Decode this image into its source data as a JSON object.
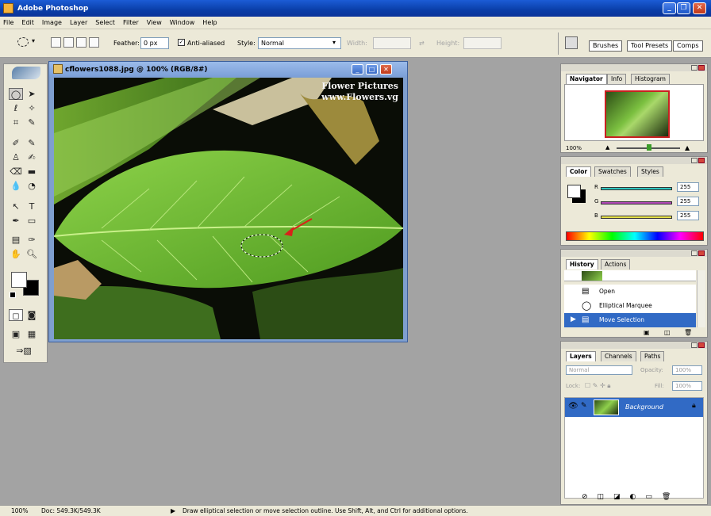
{
  "app": {
    "title": "Adobe Photoshop"
  },
  "menu": [
    "File",
    "Edit",
    "Image",
    "Layer",
    "Select",
    "Filter",
    "View",
    "Window",
    "Help"
  ],
  "options": {
    "feather_label": "Feather:",
    "feather_value": "0 px",
    "antialiased_label": "Anti-aliased",
    "style_label": "Style:",
    "style_value": "Normal",
    "width_label": "Width:",
    "height_label": "Height:",
    "tabs": [
      "Brushes",
      "Tool Presets",
      "Comps"
    ]
  },
  "document": {
    "title": "cflowers1088.jpg @ 100% (RGB/8#)",
    "watermark_line1": "Flower Pictures",
    "watermark_line2": "www.Flowers.vg"
  },
  "navigator": {
    "tabs": [
      "Navigator",
      "Info",
      "Histogram"
    ],
    "zoom": "100%"
  },
  "color": {
    "tabs": [
      "Color",
      "Swatches",
      "Styles"
    ],
    "channels": [
      {
        "label": "R",
        "value": "255",
        "color": "#2fc7c0"
      },
      {
        "label": "G",
        "value": "255",
        "color": "#b34ab8"
      },
      {
        "label": "B",
        "value": "255",
        "color": "#e4e04a"
      }
    ]
  },
  "history": {
    "tabs": [
      "History",
      "Actions"
    ],
    "items": [
      {
        "label": "Open",
        "icon": "document-icon"
      },
      {
        "label": "Elliptical Marquee",
        "icon": "ellipse-icon"
      },
      {
        "label": "Move Selection",
        "icon": "document-icon"
      }
    ]
  },
  "layers": {
    "tabs": [
      "Layers",
      "Channels",
      "Paths"
    ],
    "blend_mode": "Normal",
    "opacity_label": "Opacity:",
    "opacity_value": "100%",
    "lock_label": "Lock:",
    "fill_label": "Fill:",
    "fill_value": "100%",
    "layer_name": "Background"
  },
  "status": {
    "zoom": "100%",
    "doc": "Doc: 549.3K/549.3K",
    "hint": "Draw elliptical selection or move selection outline. Use Shift, Alt, and Ctrl for additional options."
  },
  "colors": {
    "selection_blue": "#316ac5",
    "ui_bg": "#ece9d8",
    "workspace": "#a3a3a3"
  }
}
